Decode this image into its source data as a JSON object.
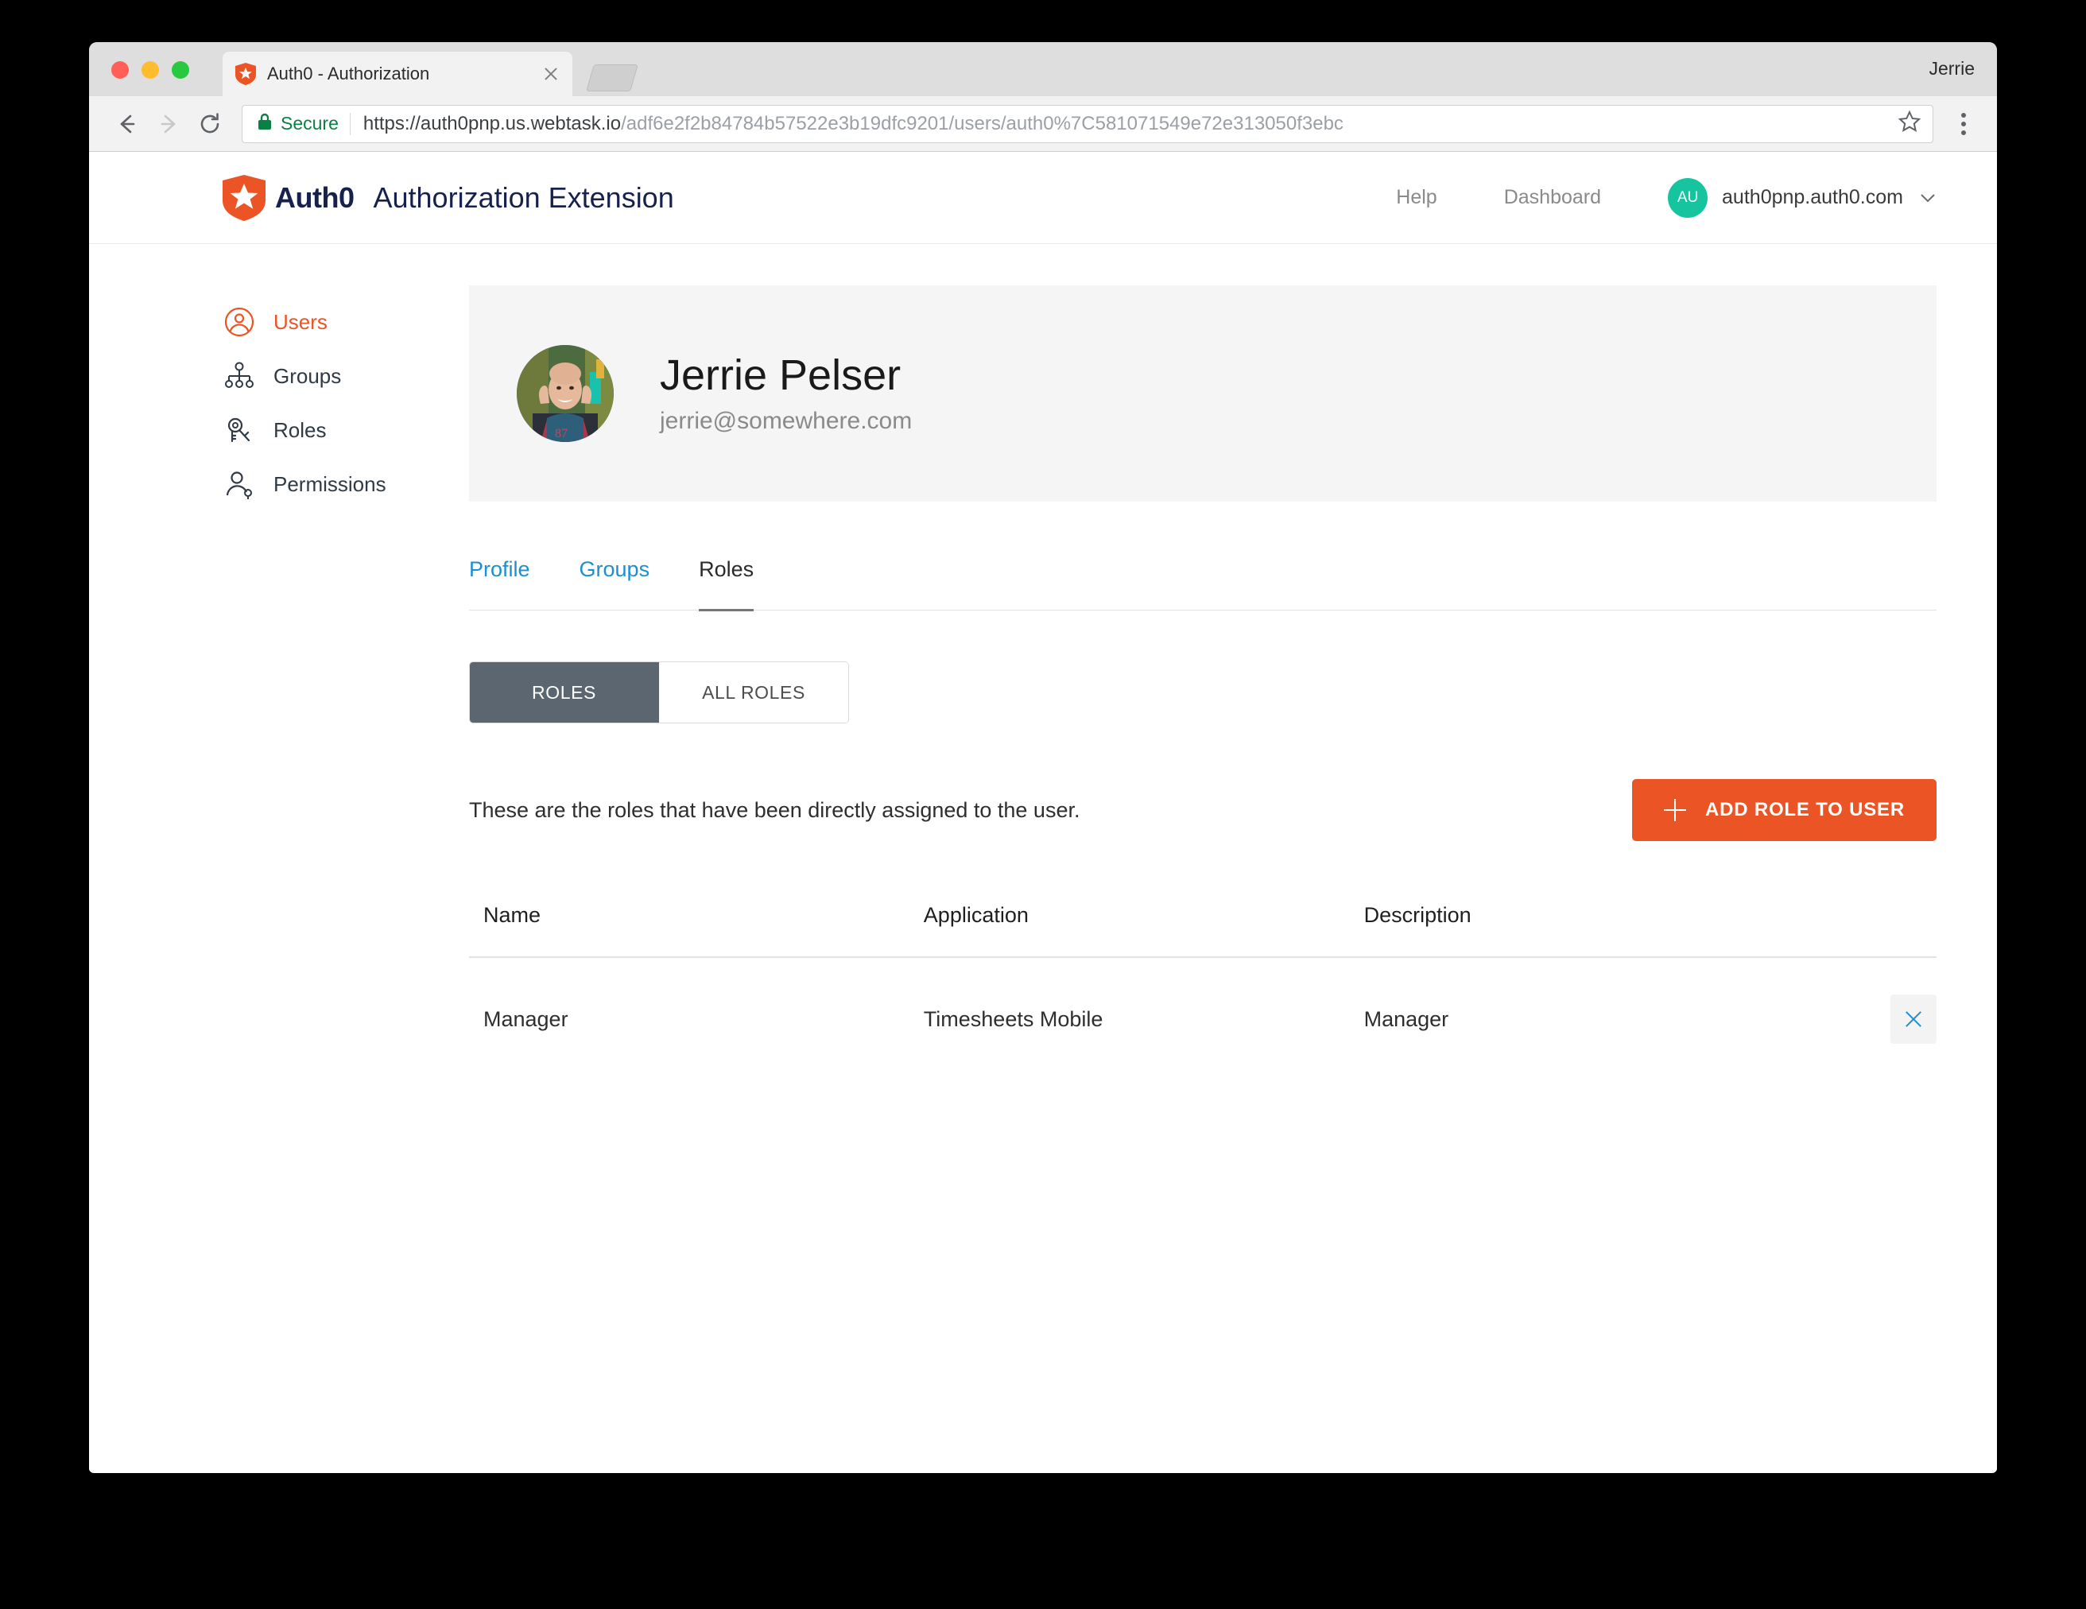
{
  "browser": {
    "profile_label": "Jerrie",
    "tab": {
      "title": "Auth0 - Authorization",
      "favicon_icon": "auth0-shield-icon",
      "close_icon": "close-icon"
    },
    "new_tab_icon": "new-tab-icon",
    "nav": {
      "back_icon": "back-arrow-icon",
      "forward_icon": "forward-arrow-icon",
      "reload_icon": "reload-icon"
    },
    "omnibox": {
      "lock_icon": "lock-icon",
      "secure_label": "Secure",
      "url_host": "https://auth0pnp.us.webtask.io",
      "url_path": "/adf6e2f2b84784b57522e3b19dfc9201/users/auth0%7C581071549e72e313050f3ebc",
      "star_icon": "bookmark-star-icon"
    },
    "menu_icon": "three-dot-menu-icon"
  },
  "header": {
    "brand_word": "Auth0",
    "brand_logo_icon": "auth0-logo-icon",
    "title": "Authorization Extension",
    "links": [
      {
        "label": "Help"
      },
      {
        "label": "Dashboard"
      }
    ],
    "tenant": {
      "initials": "AU",
      "name": "auth0pnp.auth0.com",
      "chevron_icon": "chevron-down-icon"
    }
  },
  "sidebar": {
    "items": [
      {
        "label": "Users",
        "icon": "user-circle-icon",
        "active": true
      },
      {
        "label": "Groups",
        "icon": "org-chart-icon",
        "active": false
      },
      {
        "label": "Roles",
        "icon": "key-icon",
        "active": false
      },
      {
        "label": "Permissions",
        "icon": "user-key-icon",
        "active": false
      }
    ]
  },
  "profile": {
    "name": "Jerrie Pelser",
    "email": "jerrie@somewhere.com",
    "avatar_icon": "user-photo-avatar"
  },
  "tabs": [
    {
      "label": "Profile",
      "active": false
    },
    {
      "label": "Groups",
      "active": false
    },
    {
      "label": "Roles",
      "active": true
    }
  ],
  "segmented": [
    {
      "label": "ROLES",
      "active": true
    },
    {
      "label": "ALL ROLES",
      "active": false
    }
  ],
  "main": {
    "description": "These are the roles that have been directly assigned to the user.",
    "add_button": {
      "label": "ADD ROLE TO USER",
      "icon": "plus-icon"
    }
  },
  "table": {
    "columns": [
      "Name",
      "Application",
      "Description"
    ],
    "rows": [
      {
        "name": "Manager",
        "application": "Timesheets Mobile",
        "description": "Manager",
        "remove_icon": "close-x-icon"
      }
    ]
  },
  "colors": {
    "brand_orange": "#eb5424",
    "link_blue": "#1d8fd1",
    "tenant_teal": "#16c5a0",
    "segment_active": "#5b6670",
    "secure_green": "#0a8043",
    "brand_navy": "#16214d"
  }
}
